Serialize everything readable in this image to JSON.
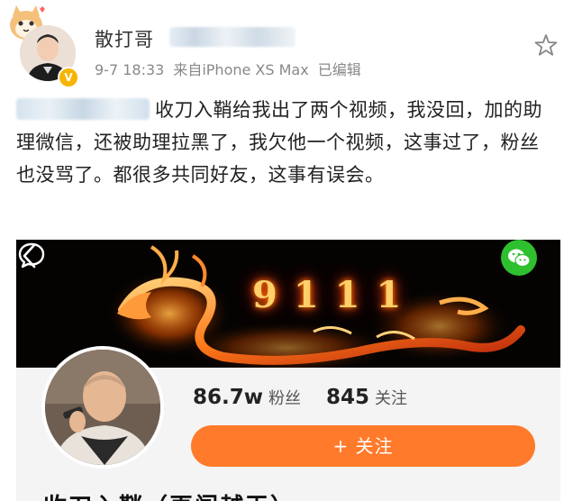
{
  "post": {
    "author_name": "散打哥",
    "timestamp": "9-7 18:33",
    "source": "来自iPhone XS Max",
    "edited": "已编辑",
    "text_after_mention": "收刀入鞘给我出了两个视频，我没回，加的助理微信，还被助理拉黑了，我欠他一个视频，这事过了，粉丝也没骂了。都很多共同好友，这事有误会。"
  },
  "card": {
    "banner_number": "9111",
    "followers_value": "86.7w",
    "followers_label": "粉丝",
    "following_value": "845",
    "following_label": "关注",
    "follow_button": "+ 关注",
    "name": "收刀入鞘（再闯越王）"
  },
  "icons": {
    "star": "star-outline",
    "back": "chevron-left",
    "chat": "speech-bubble",
    "wechat": "wechat-logo",
    "verified": "verified-badge"
  },
  "colors": {
    "accent": "#ff7a2a",
    "wechat": "#2ec02e",
    "verified": "#f7b500"
  }
}
